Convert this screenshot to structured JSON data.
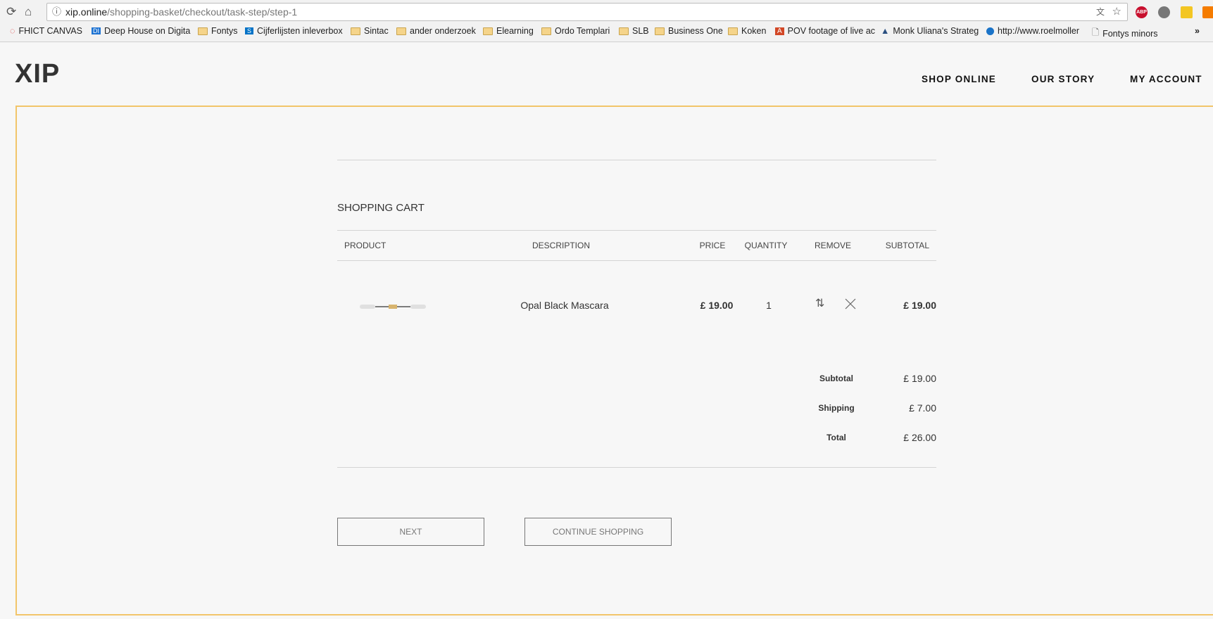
{
  "browser": {
    "url_host": "xip.online",
    "url_path": "/shopping-basket/checkout/task-step/step-1",
    "bookmarks": [
      "FHICT CANVAS",
      "Deep House on Digita",
      "Fontys",
      "Cijferlijsten inleverbox",
      "Sintac",
      "ander onderzoek",
      "Elearning",
      "Ordo Templari",
      "SLB",
      "Business One",
      "Koken",
      "POV footage of live ac",
      "Monk Uliana's Strateg",
      "http://www.roelmoller",
      "Fontys minors"
    ],
    "more": "»",
    "ext_abp": "ABP"
  },
  "site": {
    "logo": "XIP",
    "nav": [
      "SHOP ONLINE",
      "OUR STORY",
      "MY ACCOUNT"
    ]
  },
  "cart": {
    "title": "SHOPPING CART",
    "headers": {
      "product": "PRODUCT",
      "description": "DESCRIPTION",
      "price": "PRICE",
      "quantity": "QUANTITY",
      "remove": "REMOVE",
      "subtotal": "SUBTOTAL"
    },
    "items": [
      {
        "description": "Opal Black Mascara",
        "price": "£ 19.00",
        "quantity": "1",
        "subtotal": "£ 19.00"
      }
    ],
    "summary": {
      "subtotal_label": "Subtotal",
      "subtotal": "£ 19.00",
      "shipping_label": "Shipping",
      "shipping": "£ 7.00",
      "total_label": "Total",
      "total": "£ 26.00"
    },
    "next": "NEXT",
    "continue": "CONTINUE SHOPPING"
  }
}
